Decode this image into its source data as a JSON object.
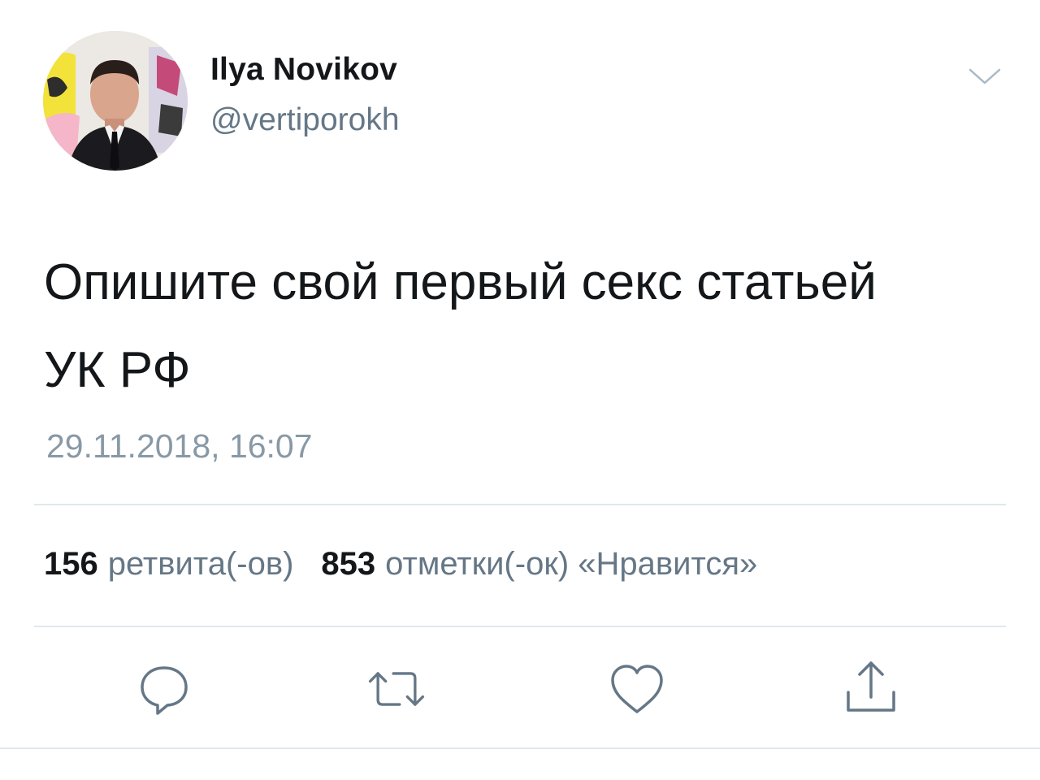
{
  "author": {
    "display_name": "Ilya Novikov",
    "handle": "@vertiporokh"
  },
  "tweet": {
    "text_line1": "Опишите свой первый секс статьей",
    "text_line2": "УК РФ",
    "timestamp": "29.11.2018, 16:07"
  },
  "stats": {
    "retweets_count": "156",
    "retweets_label": "ретвита(-ов)",
    "likes_count": "853",
    "likes_label": "отметки(-ок) «Нравится»"
  },
  "icons": {
    "menu": "chevron-down-icon",
    "reply": "reply-icon",
    "retweet": "retweet-icon",
    "like": "heart-icon",
    "share": "share-icon"
  },
  "colors": {
    "text": "#14171a",
    "secondary": "#657786",
    "timestamp": "#8899a6",
    "divider": "#e1e8ed",
    "icon": "#657786"
  }
}
